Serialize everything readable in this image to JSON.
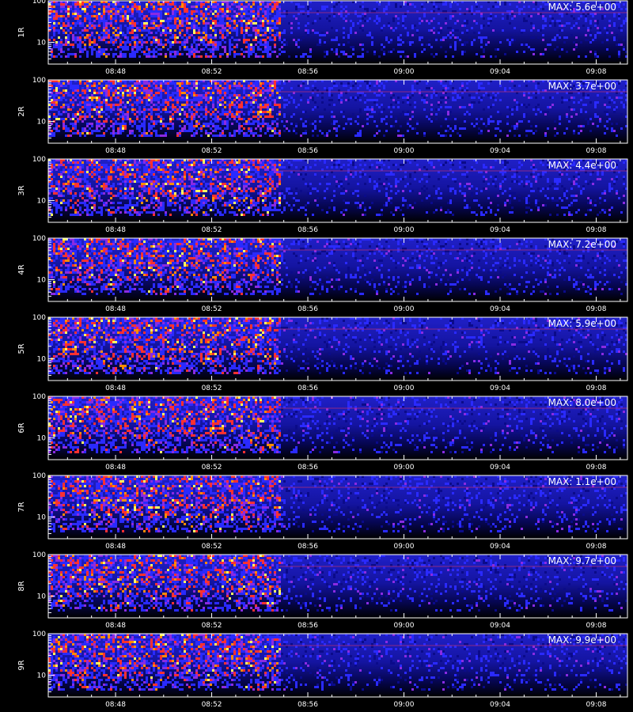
{
  "chart_data": {
    "type": "heatmap",
    "x_tick_labels": [
      "08:48",
      "08:52",
      "08:56",
      "09:00",
      "09:04",
      "09:08"
    ],
    "x_tick_minutes": [
      288,
      292,
      296,
      300,
      304,
      308
    ],
    "x_range_minutes": [
      285.2,
      309.3
    ],
    "y_scale": "log",
    "y_range": [
      3,
      100
    ],
    "y_tick_labels": [
      "100",
      "10"
    ],
    "bright_region_end_minutes": 294.8,
    "colors": {
      "background": "#000000",
      "low": "#0b0b8a",
      "mid": "#2a2aff",
      "high": "#ff3030",
      "peak": "#ffff60"
    },
    "panels": [
      {
        "label": "1R",
        "max_text": "MAX: 5.6e+00",
        "max": 5.6
      },
      {
        "label": "2R",
        "max_text": "MAX: 3.7e+00",
        "max": 3.7
      },
      {
        "label": "3R",
        "max_text": "MAX: 4.4e+00",
        "max": 4.4
      },
      {
        "label": "4R",
        "max_text": "MAX: 7.2e+00",
        "max": 7.2
      },
      {
        "label": "5R",
        "max_text": "MAX: 5.9e+00",
        "max": 5.9
      },
      {
        "label": "6R",
        "max_text": "MAX: 8.0e+00",
        "max": 8.0
      },
      {
        "label": "7R",
        "max_text": "MAX: 1.1e+00",
        "max": 1.1
      },
      {
        "label": "8R",
        "max_text": "MAX: 9.7e+00",
        "max": 9.7
      },
      {
        "label": "9R",
        "max_text": "MAX: 9.9e+00",
        "max": 9.9
      }
    ]
  }
}
